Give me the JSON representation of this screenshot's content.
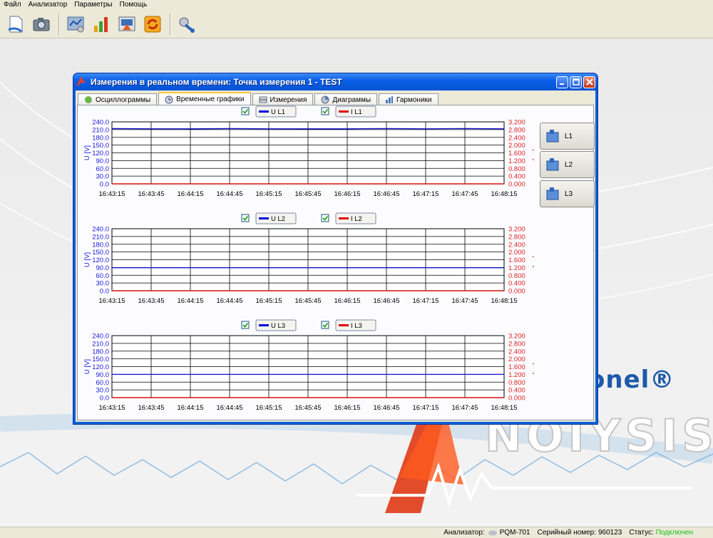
{
  "menu": [
    "Файл",
    "Анализатор",
    "Параметры",
    "Помощь"
  ],
  "toolbar": [
    "document-icon",
    "camera-icon",
    "config-icon",
    "bar-chart-icon",
    "report-icon",
    "refresh-icon",
    "connect-icon"
  ],
  "brand": "onel®",
  "window": {
    "title": "Измерения в реальном времени: Точка измерения 1 - TEST",
    "tabs": [
      {
        "label": "Осциллограммы",
        "active": false
      },
      {
        "label": "Временные графики",
        "active": true
      },
      {
        "label": "Измерения",
        "active": false
      },
      {
        "label": "Диаграммы",
        "active": false
      },
      {
        "label": "Гармоники",
        "active": false
      }
    ]
  },
  "side_buttons": [
    "L1",
    "L2",
    "L3"
  ],
  "chart_data": [
    {
      "type": "line",
      "title": "",
      "xlabel": "",
      "ylabel": "U [V]",
      "y2label": "I [kA]",
      "legend": [
        {
          "label": "U L1",
          "color": "#0000e0",
          "checked": true
        },
        {
          "label": "I L1",
          "color": "#e00000",
          "checked": true
        }
      ],
      "x": [
        "16:43:15",
        "16:43:45",
        "16:44:15",
        "16:44:45",
        "16:45:15",
        "16:45:45",
        "16:46:15",
        "16:46:45",
        "16:47:15",
        "16:47:45",
        "16:48:15"
      ],
      "ylim": [
        0,
        240
      ],
      "y2lim": [
        0,
        3.2
      ],
      "yticks": [
        "0.0",
        "30.0",
        "60.0",
        "90.0",
        "120.0",
        "150.0",
        "180.0",
        "210.0",
        "240.0"
      ],
      "y2ticks": [
        "0.000",
        "0.400",
        "0.800",
        "1.200",
        "1.600",
        "2.000",
        "2.400",
        "2.800",
        "3.200"
      ],
      "series": [
        {
          "values": [
            214,
            213,
            213,
            214,
            213,
            213,
            213,
            214,
            213,
            214,
            213
          ]
        },
        {
          "values": [
            0,
            0,
            0,
            0,
            0,
            0,
            0,
            0,
            0,
            0,
            0
          ]
        }
      ],
      "grid": true
    },
    {
      "type": "line",
      "title": "",
      "xlabel": "",
      "ylabel": "U [V]",
      "y2label": "I [kA]",
      "legend": [
        {
          "label": "U L2",
          "color": "#0000e0",
          "checked": true
        },
        {
          "label": "I L2",
          "color": "#e00000",
          "checked": true
        }
      ],
      "x": [
        "16:43:15",
        "16:43:45",
        "16:44:15",
        "16:44:45",
        "16:45:15",
        "16:45:45",
        "16:46:15",
        "16:46:45",
        "16:47:15",
        "16:47:45",
        "16:48:15"
      ],
      "ylim": [
        0,
        240
      ],
      "y2lim": [
        0,
        3.2
      ],
      "yticks": [
        "0.0",
        "30.0",
        "60.0",
        "90.0",
        "120.0",
        "150.0",
        "180.0",
        "210.0",
        "240.0"
      ],
      "y2ticks": [
        "0.000",
        "0.400",
        "0.800",
        "1.200",
        "1.600",
        "2.000",
        "2.400",
        "2.800",
        "3.200"
      ],
      "series": [
        {
          "values": [
            89,
            89,
            89,
            89,
            89,
            89,
            89,
            89,
            89,
            89,
            89
          ]
        },
        {
          "values": [
            0,
            0,
            0,
            0,
            0,
            0,
            0,
            0,
            0,
            0,
            0
          ]
        }
      ],
      "grid": true
    },
    {
      "type": "line",
      "title": "",
      "xlabel": "",
      "ylabel": "U [V]",
      "y2label": "I [kA]",
      "legend": [
        {
          "label": "U L3",
          "color": "#0000e0",
          "checked": true
        },
        {
          "label": "I L3",
          "color": "#e00000",
          "checked": true
        }
      ],
      "x": [
        "16:43:15",
        "16:43:45",
        "16:44:15",
        "16:44:45",
        "16:45:15",
        "16:45:45",
        "16:46:15",
        "16:46:45",
        "16:47:15",
        "16:47:45",
        "16:48:15"
      ],
      "ylim": [
        0,
        240
      ],
      "y2lim": [
        0,
        3.2
      ],
      "yticks": [
        "0.0",
        "30.0",
        "60.0",
        "90.0",
        "120.0",
        "150.0",
        "180.0",
        "210.0",
        "240.0"
      ],
      "y2ticks": [
        "0.000",
        "0.400",
        "0.800",
        "1.200",
        "1.600",
        "2.000",
        "2.400",
        "2.800",
        "3.200"
      ],
      "series": [
        {
          "values": [
            90,
            90,
            90,
            90,
            90,
            90,
            90,
            90,
            90,
            90,
            90
          ]
        },
        {
          "values": [
            0,
            0,
            0,
            0,
            0,
            0,
            0,
            0,
            0,
            0,
            0
          ]
        }
      ],
      "grid": true
    }
  ],
  "status": {
    "analyzer_label": "Анализатор:",
    "analyzer_value": "PQM-701",
    "serial_label": "Серийный номер:",
    "serial_value": "960123",
    "status_label": "Статус:",
    "status_value": "Подключен"
  }
}
